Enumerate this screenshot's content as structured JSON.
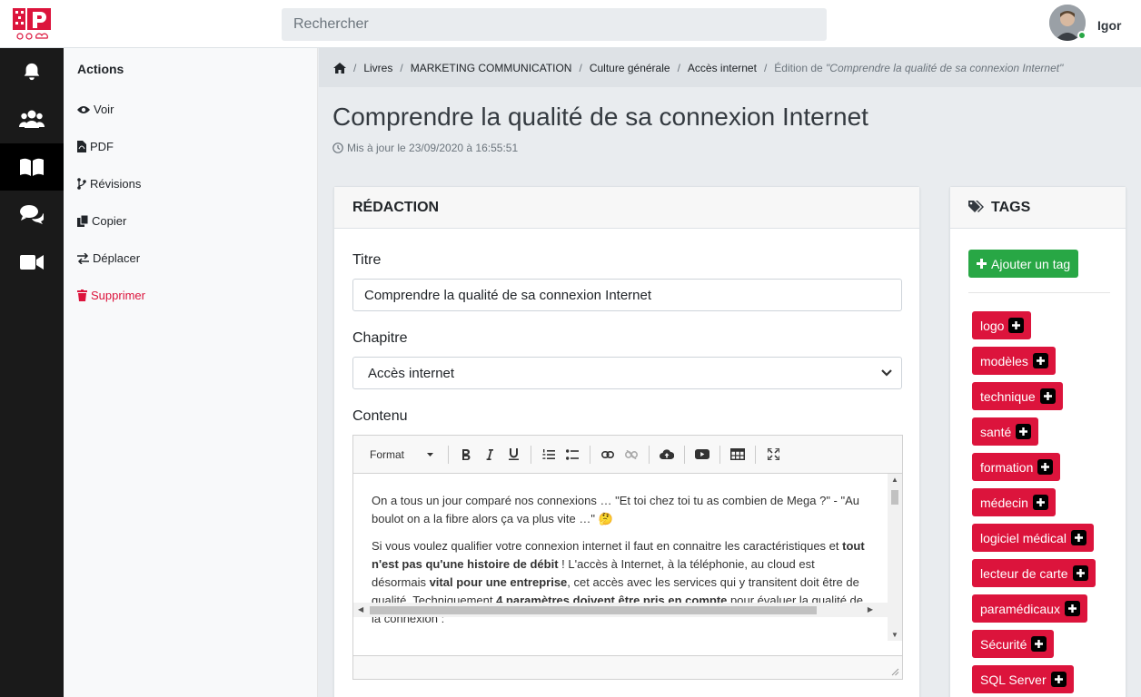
{
  "header": {
    "search_placeholder": "Rechercher",
    "username": "Igor",
    "status_color": "#28a745"
  },
  "rail": {
    "items": [
      {
        "icon": "bell-icon"
      },
      {
        "icon": "users-icon"
      },
      {
        "icon": "book-icon",
        "active": true
      },
      {
        "icon": "comments-icon"
      },
      {
        "icon": "video-icon"
      }
    ]
  },
  "actions": {
    "title": "Actions",
    "items": [
      {
        "label": "Voir",
        "icon": "eye-icon"
      },
      {
        "label": "PDF",
        "icon": "file-pdf-icon"
      },
      {
        "label": "Révisions",
        "icon": "branch-icon"
      },
      {
        "label": "Copier",
        "icon": "copy-icon"
      },
      {
        "label": "Déplacer",
        "icon": "exchange-icon"
      },
      {
        "label": "Supprimer",
        "icon": "trash-icon",
        "danger": true
      }
    ]
  },
  "breadcrumb": {
    "items": [
      "Livres",
      "MARKETING COMMUNICATION",
      "Culture générale",
      "Accès internet"
    ],
    "current_prefix": "Édition de ",
    "current_title": "\"Comprendre la qualité de sa connexion Internet\""
  },
  "page": {
    "title": "Comprendre la qualité de sa connexion Internet",
    "updated": "Mis à jour le 23/09/2020 à 16:55:51"
  },
  "redaction": {
    "header": "RÉDACTION",
    "title_label": "Titre",
    "title_value": "Comprendre la qualité de sa connexion Internet",
    "chapter_label": "Chapitre",
    "chapter_value": "Accès internet",
    "content_label": "Contenu",
    "toolbar": {
      "format_label": "Format",
      "buttons": [
        "bold",
        "italic",
        "underline",
        "ordered-list",
        "bullet-list",
        "link",
        "unlink",
        "upload",
        "video",
        "table",
        "fullscreen"
      ]
    },
    "content": {
      "p1": "On a tous un jour comparé nos connexions … \"Et toi chez toi tu as combien de Mega ?\" -  \"Au boulot on a la fibre alors ça va plus vite …\"",
      "p2_a": "Si vous voulez qualifier votre connexion internet il faut en connaitre les caractéristiques et ",
      "p2_b": "tout n'est pas qu'une histoire de débit",
      "p2_c": " ! L'accès à Internet, à la téléphonie, au cloud est désormais ",
      "p2_d": "vital pour une entreprise",
      "p2_e": ", cet accès avec les services qui y transitent doit être de qualité. Techniquement ",
      "p2_f": "4 paramètres doivent être pris en compte",
      "p2_g": " pour évaluer la qualité de la connexion :"
    }
  },
  "tags": {
    "header": "TAGS",
    "add_label": "Ajouter un tag",
    "add_color": "#28a745",
    "tag_color": "#dc143c",
    "items": [
      "logo",
      "modèles",
      "technique",
      "santé",
      "formation",
      "médecin",
      "logiciel médical",
      "lecteur de carte",
      "paramédicaux",
      "Sécurité",
      "SQL Server"
    ]
  }
}
